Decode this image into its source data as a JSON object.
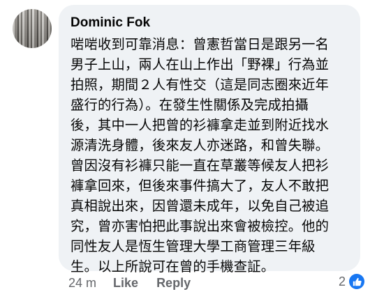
{
  "comment": {
    "author": "Dominic Fok",
    "lines": [
      "啱啱收到可靠消息：曾憲哲當日是跟另一名",
      "男子上山，兩人在山上作出「野裸」行為並",
      "拍照，期間２人有性交（這是同志圈來近年",
      "盛行的行為）。在發生性關係及完成拍攝",
      "後，其中一人把曾的衫褲拿走並到附近找水",
      "源清洗身體，後來友人亦迷路，和曾失聯。",
      "曾因沒有衫褲只能一直在草叢等候友人把衫",
      "褲拿回來，但後來事件搞大了，友人不敢把",
      "真相說出來，因曾還未成年，以免自己被追",
      "究，曾亦害怕把此事說出來會被檢控。他的",
      "同性友人是恆生管理大學工商管理三年級",
      "生。以上所說可在曾的手機查証。"
    ],
    "time": "24 m",
    "like_label": "Like",
    "reply_label": "Reply",
    "reaction_count": "2",
    "reaction_icon": "thumbs-up-icon",
    "colors": {
      "bubble": "#eff2f5",
      "text": "#050505",
      "meta": "#65676b",
      "like_blue": "#1877f2"
    }
  }
}
